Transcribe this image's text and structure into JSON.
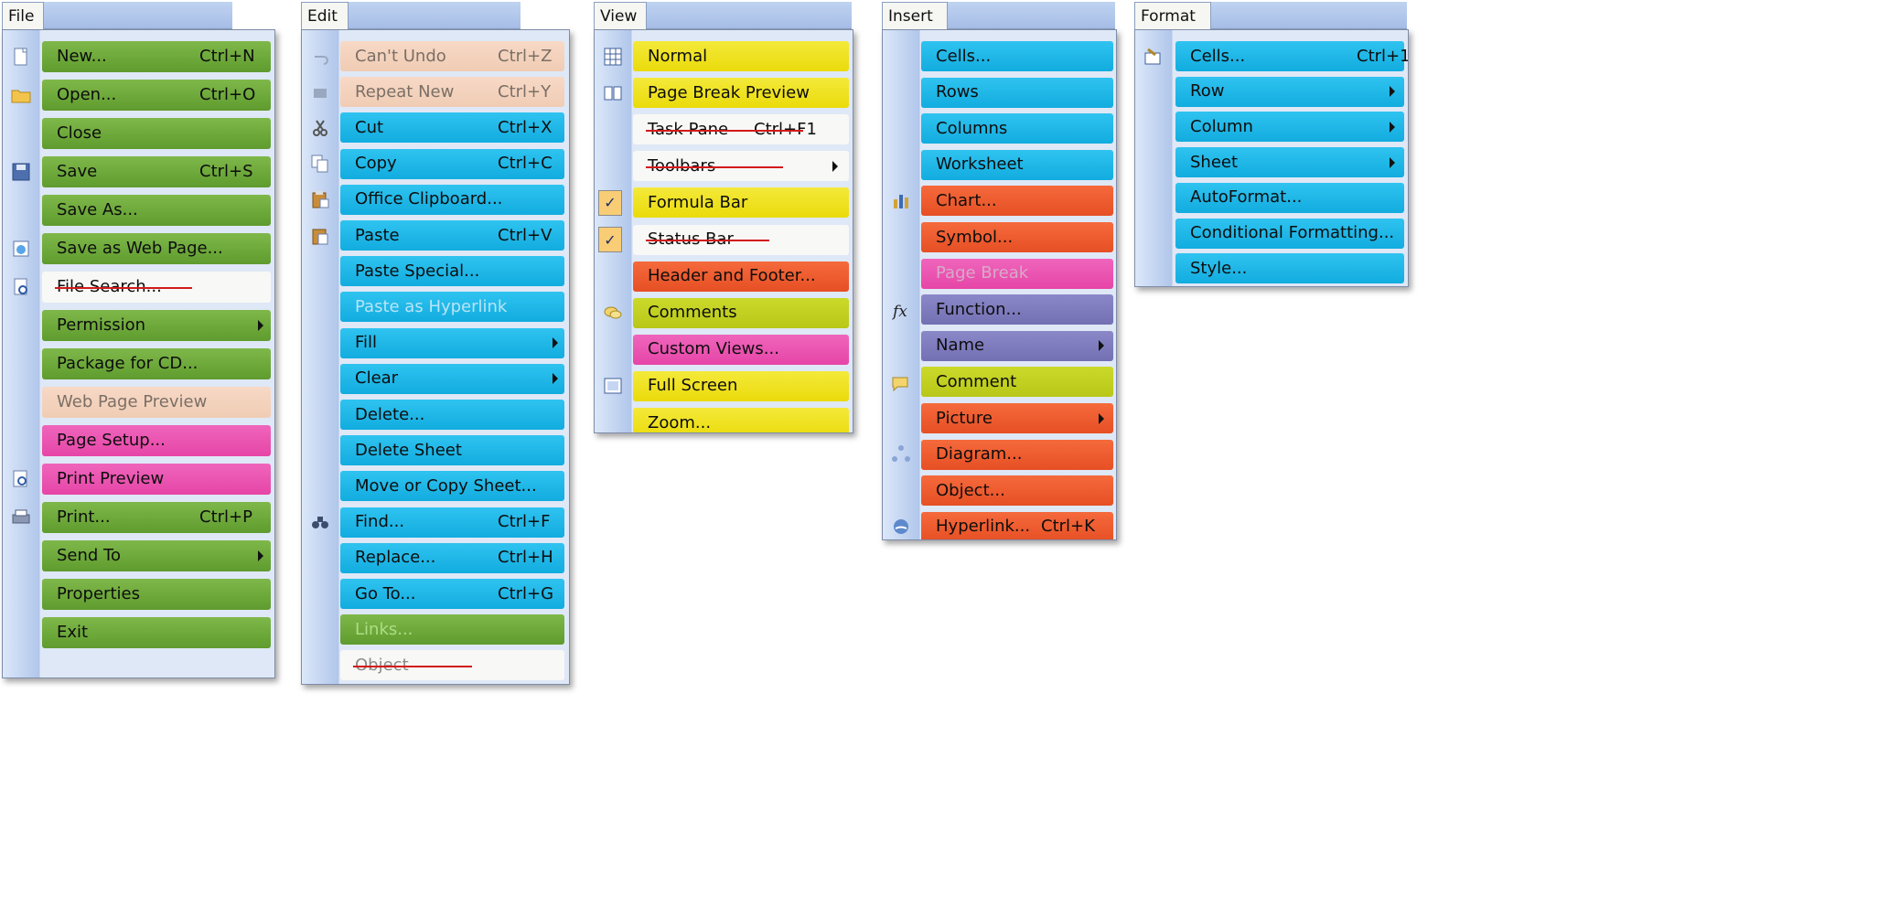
{
  "menus": {
    "file": {
      "tab": "File",
      "items": [
        {
          "label": "New...",
          "shortcut": "Ctrl+N",
          "icon": "new-document-icon"
        },
        {
          "label": "Open...",
          "shortcut": "Ctrl+O",
          "icon": "open-folder-icon"
        },
        {
          "label": "Close",
          "shortcut": ""
        },
        {
          "label": "Save",
          "shortcut": "Ctrl+S",
          "icon": "save-disk-icon"
        },
        {
          "label": "Save As...",
          "shortcut": ""
        },
        {
          "label": "Save as Web Page...",
          "shortcut": "",
          "icon": "web-page-icon"
        },
        {
          "label": "File Search...",
          "shortcut": "",
          "icon": "file-search-icon",
          "struck": true
        },
        {
          "label": "Permission",
          "shortcut": "",
          "submenu": true
        },
        {
          "label": "Package for CD...",
          "shortcut": ""
        },
        {
          "label": "Web Page Preview",
          "shortcut": ""
        },
        {
          "label": "Page Setup...",
          "shortcut": ""
        },
        {
          "label": "Print Preview",
          "shortcut": "",
          "icon": "print-preview-icon"
        },
        {
          "label": "Print...",
          "shortcut": "Ctrl+P",
          "icon": "printer-icon"
        },
        {
          "label": "Send To",
          "shortcut": "",
          "submenu": true
        },
        {
          "label": "Properties",
          "shortcut": ""
        },
        {
          "label": "Exit",
          "shortcut": ""
        }
      ]
    },
    "edit": {
      "tab": "Edit",
      "items": [
        {
          "label": "Can't Undo",
          "shortcut": "Ctrl+Z",
          "icon": "undo-icon"
        },
        {
          "label": "Repeat New",
          "shortcut": "Ctrl+Y",
          "icon": "repeat-icon"
        },
        {
          "label": "Cut",
          "shortcut": "Ctrl+X",
          "icon": "scissors-icon"
        },
        {
          "label": "Copy",
          "shortcut": "Ctrl+C",
          "icon": "copy-icon"
        },
        {
          "label": "Office Clipboard...",
          "shortcut": "",
          "icon": "clipboard-icon"
        },
        {
          "label": "Paste",
          "shortcut": "Ctrl+V",
          "icon": "paste-icon"
        },
        {
          "label": "Paste Special...",
          "shortcut": ""
        },
        {
          "label": "Paste as Hyperlink",
          "shortcut": ""
        },
        {
          "label": "Fill",
          "shortcut": "",
          "submenu": true
        },
        {
          "label": "Clear",
          "shortcut": "",
          "submenu": true
        },
        {
          "label": "Delete...",
          "shortcut": ""
        },
        {
          "label": "Delete Sheet",
          "shortcut": ""
        },
        {
          "label": "Move or Copy Sheet...",
          "shortcut": ""
        },
        {
          "label": "Find...",
          "shortcut": "Ctrl+F",
          "icon": "binoculars-icon"
        },
        {
          "label": "Replace...",
          "shortcut": "Ctrl+H"
        },
        {
          "label": "Go To...",
          "shortcut": "Ctrl+G"
        },
        {
          "label": "Links...",
          "shortcut": ""
        },
        {
          "label": "Object",
          "shortcut": "",
          "struck": true
        }
      ]
    },
    "view": {
      "tab": "View",
      "items": [
        {
          "label": "Normal",
          "shortcut": "",
          "icon": "normal-view-icon"
        },
        {
          "label": "Page Break Preview",
          "shortcut": "",
          "icon": "page-break-preview-icon"
        },
        {
          "label": "Task Pane",
          "shortcut": "Ctrl+F1",
          "struck": true
        },
        {
          "label": "Toolbars",
          "shortcut": "",
          "submenu": true,
          "struck": true
        },
        {
          "label": "Formula Bar",
          "shortcut": "",
          "checked": true
        },
        {
          "label": "Status Bar",
          "shortcut": "",
          "checked": true,
          "struck": true
        },
        {
          "label": "Header and Footer...",
          "shortcut": ""
        },
        {
          "label": "Comments",
          "shortcut": "",
          "icon": "comments-icon"
        },
        {
          "label": "Custom Views...",
          "shortcut": ""
        },
        {
          "label": "Full Screen",
          "shortcut": "",
          "icon": "full-screen-icon"
        },
        {
          "label": "Zoom...",
          "shortcut": ""
        }
      ]
    },
    "insert": {
      "tab": "Insert",
      "items": [
        {
          "label": "Cells...",
          "shortcut": ""
        },
        {
          "label": "Rows",
          "shortcut": ""
        },
        {
          "label": "Columns",
          "shortcut": ""
        },
        {
          "label": "Worksheet",
          "shortcut": ""
        },
        {
          "label": "Chart...",
          "shortcut": "",
          "icon": "chart-icon"
        },
        {
          "label": "Symbol...",
          "shortcut": ""
        },
        {
          "label": "Page Break",
          "shortcut": ""
        },
        {
          "label": "Function...",
          "shortcut": "",
          "icon": "function-icon"
        },
        {
          "label": "Name",
          "shortcut": "",
          "submenu": true
        },
        {
          "label": "Comment",
          "shortcut": "",
          "icon": "comment-icon"
        },
        {
          "label": "Picture",
          "shortcut": "",
          "submenu": true
        },
        {
          "label": "Diagram...",
          "shortcut": "",
          "icon": "diagram-icon"
        },
        {
          "label": "Object...",
          "shortcut": ""
        },
        {
          "label": "Hyperlink...",
          "shortcut": "Ctrl+K",
          "icon": "hyperlink-icon"
        }
      ]
    },
    "format": {
      "tab": "Format",
      "items": [
        {
          "label": "Cells...",
          "shortcut": "Ctrl+1",
          "icon": "format-cells-icon"
        },
        {
          "label": "Row",
          "shortcut": "",
          "submenu": true
        },
        {
          "label": "Column",
          "shortcut": "",
          "submenu": true
        },
        {
          "label": "Sheet",
          "shortcut": "",
          "submenu": true
        },
        {
          "label": "AutoFormat...",
          "shortcut": ""
        },
        {
          "label": "Conditional Formatting...",
          "shortcut": ""
        },
        {
          "label": "Style...",
          "shortcut": ""
        }
      ]
    }
  },
  "colors": {
    "green": "#6aa83b",
    "blue": "#1fb6e6",
    "yellow": "#efe21f",
    "orange": "#ee5b2f",
    "pink": "#e94fb0",
    "peach": "#f4d3bd",
    "lavender": "#7f7cbe",
    "olive": "#c1d01f",
    "strike": "#d21a1a"
  }
}
